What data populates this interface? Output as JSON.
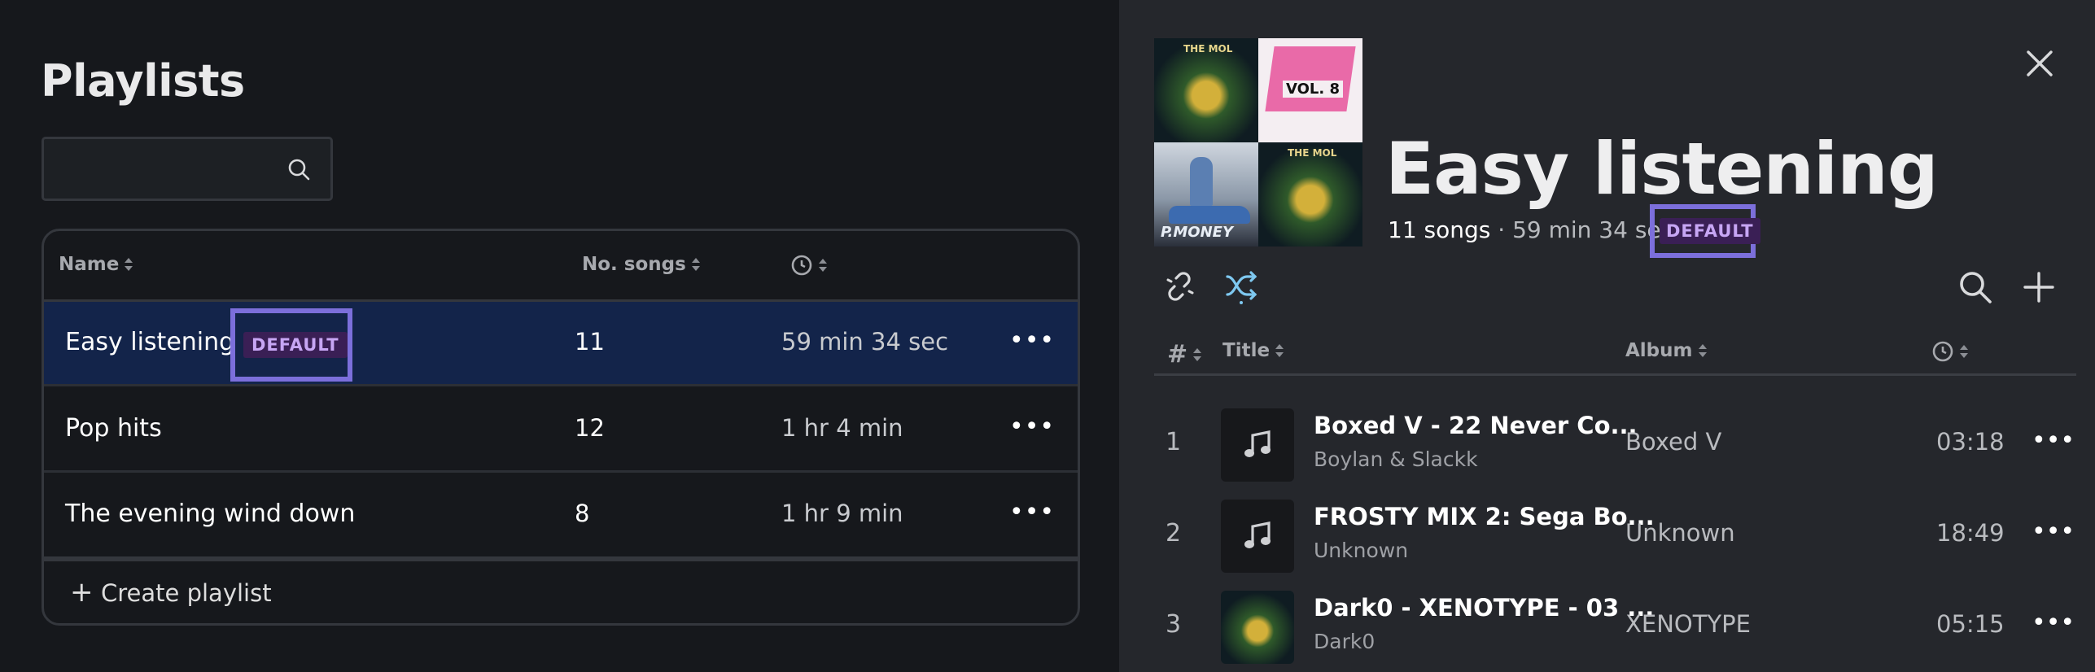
{
  "playlists_panel": {
    "title": "Playlists",
    "search": {
      "value": "",
      "placeholder": ""
    },
    "columns": {
      "name": "Name",
      "songs": "No. songs"
    },
    "rows": [
      {
        "name": "Easy listening",
        "badge": "DEFAULT",
        "count": "11",
        "duration": "59 min 34 sec",
        "more": "•••"
      },
      {
        "name": "Pop hits",
        "count": "12",
        "duration": "1 hr 4 min",
        "more": "•••"
      },
      {
        "name": "The evening wind down",
        "count": "8",
        "duration": "1 hr 9 min",
        "more": "•••"
      }
    ],
    "create_label": "Create playlist",
    "create_plus": "+"
  },
  "playlist_detail": {
    "title": "Easy listening",
    "songs": "11 songs",
    "separator": " · ",
    "duration": "59 min 34 sec",
    "badge": "DEFAULT",
    "cover_texts": {
      "c1": "THE MOL",
      "c2": "VOL. 8",
      "c3": "P.MONEY",
      "c4": "THE MOL"
    },
    "columns": {
      "num": "#",
      "title": "Title",
      "album": "Album"
    },
    "tracks": [
      {
        "num": "1",
        "title": "Boxed V - 22 Never Co...",
        "artist": "Boylan & Slackk",
        "album": "Boxed V",
        "time": "03:18",
        "more": "•••",
        "thumb": "music-note-icon"
      },
      {
        "num": "2",
        "title": "FROSTY MIX 2: Sega Bo...",
        "artist": "Unknown",
        "album": "Unknown",
        "time": "18:49",
        "more": "•••",
        "thumb": "music-note-icon"
      },
      {
        "num": "3",
        "title": "Dark0 - XENOTYPE - 03 ...",
        "artist": "Dark0",
        "album": "XENOTYPE",
        "time": "05:15",
        "more": "•••",
        "thumb": "album-art"
      }
    ]
  },
  "colors": {
    "background_left": "#16181c",
    "background_right": "#25272c",
    "selected_row": "#13244a",
    "highlight_box": "#7c6fdb",
    "badge_bg": "#3a1f55",
    "badge_text": "#c7a6f4",
    "shuffle_accent": "#7ec8f0"
  }
}
